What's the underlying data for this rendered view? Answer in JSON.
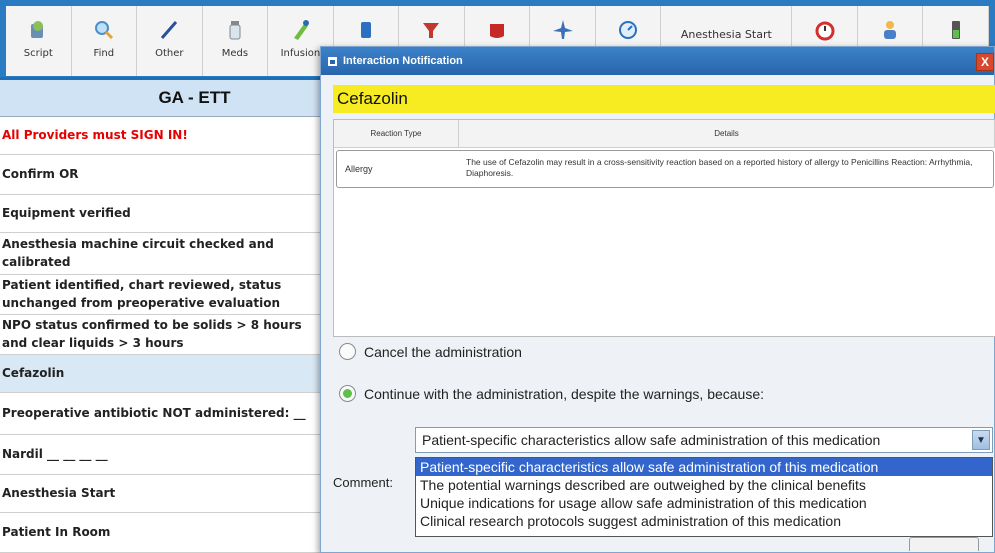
{
  "toolbar": {
    "buttons": [
      {
        "label": "Script",
        "icon": "script-icon"
      },
      {
        "label": "Find",
        "icon": "search-icon"
      },
      {
        "label": "Other",
        "icon": "pen-icon"
      },
      {
        "label": "Meds",
        "icon": "vial-icon"
      },
      {
        "label": "Infusion",
        "icon": "syringe-icon"
      },
      {
        "label": "",
        "icon": "cup-icon"
      },
      {
        "label": "",
        "icon": "funnel-icon"
      },
      {
        "label": "",
        "icon": "blood-bag-icon"
      },
      {
        "label": "",
        "icon": "airplane-icon"
      },
      {
        "label": "",
        "icon": "gauge-icon"
      },
      {
        "label": "Anesthesia Start",
        "icon": ""
      },
      {
        "label": "",
        "icon": "alarm-clock-icon"
      },
      {
        "label": "",
        "icon": "person-icon"
      },
      {
        "label": "",
        "icon": "battery-icon"
      }
    ]
  },
  "left_panel": {
    "header": "GA - ETT",
    "rows": [
      {
        "text": "All Providers must SIGN IN!",
        "style": "red"
      },
      {
        "text": "Confirm OR",
        "style": "normal"
      },
      {
        "text": "Equipment verified",
        "style": "normal"
      },
      {
        "text": "Anesthesia machine circuit checked and calibrated",
        "style": "normal"
      },
      {
        "text": "Patient identified, chart reviewed, status unchanged from preoperative evaluation",
        "style": "normal"
      },
      {
        "text": "NPO status confirmed to be solids > 8 hours and clear liquids > 3 hours",
        "style": "normal"
      },
      {
        "text": "Cefazolin",
        "style": "highlight"
      },
      {
        "text": "Preoperative antibiotic NOT administered: __",
        "style": "normal"
      },
      {
        "text": "Nardil __ __ __ __",
        "style": "normal"
      },
      {
        "text": "Anesthesia Start",
        "style": "normal"
      },
      {
        "text": "Patient In Room",
        "style": "normal"
      }
    ]
  },
  "dialog": {
    "title": "Interaction Notification",
    "close_label": "X",
    "drug": "Cefazolin",
    "grid": {
      "headers": [
        "Reaction Type",
        "Details"
      ],
      "rows": [
        {
          "type": "Allergy",
          "details": "The use of Cefazolin may result in a cross-sensitivity reaction based on a reported history of allergy to Penicillins Reaction: Arrhythmia, Diaphoresis."
        }
      ]
    },
    "options": {
      "cancel": "Cancel the administration",
      "continue": "Continue with the administration, despite the warnings, because:",
      "selected": "continue"
    },
    "comment_label": "Comment:",
    "reason_selected": "Patient-specific characteristics allow safe administration of this medication",
    "reason_options": [
      "Patient-specific characteristics allow safe administration of this medication",
      "The potential warnings described are outweighed by the clinical benefits",
      "Unique indications for usage allow safe administration of this medication",
      "Clinical research protocols suggest administration of this medication"
    ]
  },
  "colors": {
    "background": "#1f6fb8",
    "drug_highlight": "#f6ec21",
    "alert_red": "#e60000",
    "selection_blue": "#3266cc",
    "header_blue": "#cfe3f5"
  }
}
